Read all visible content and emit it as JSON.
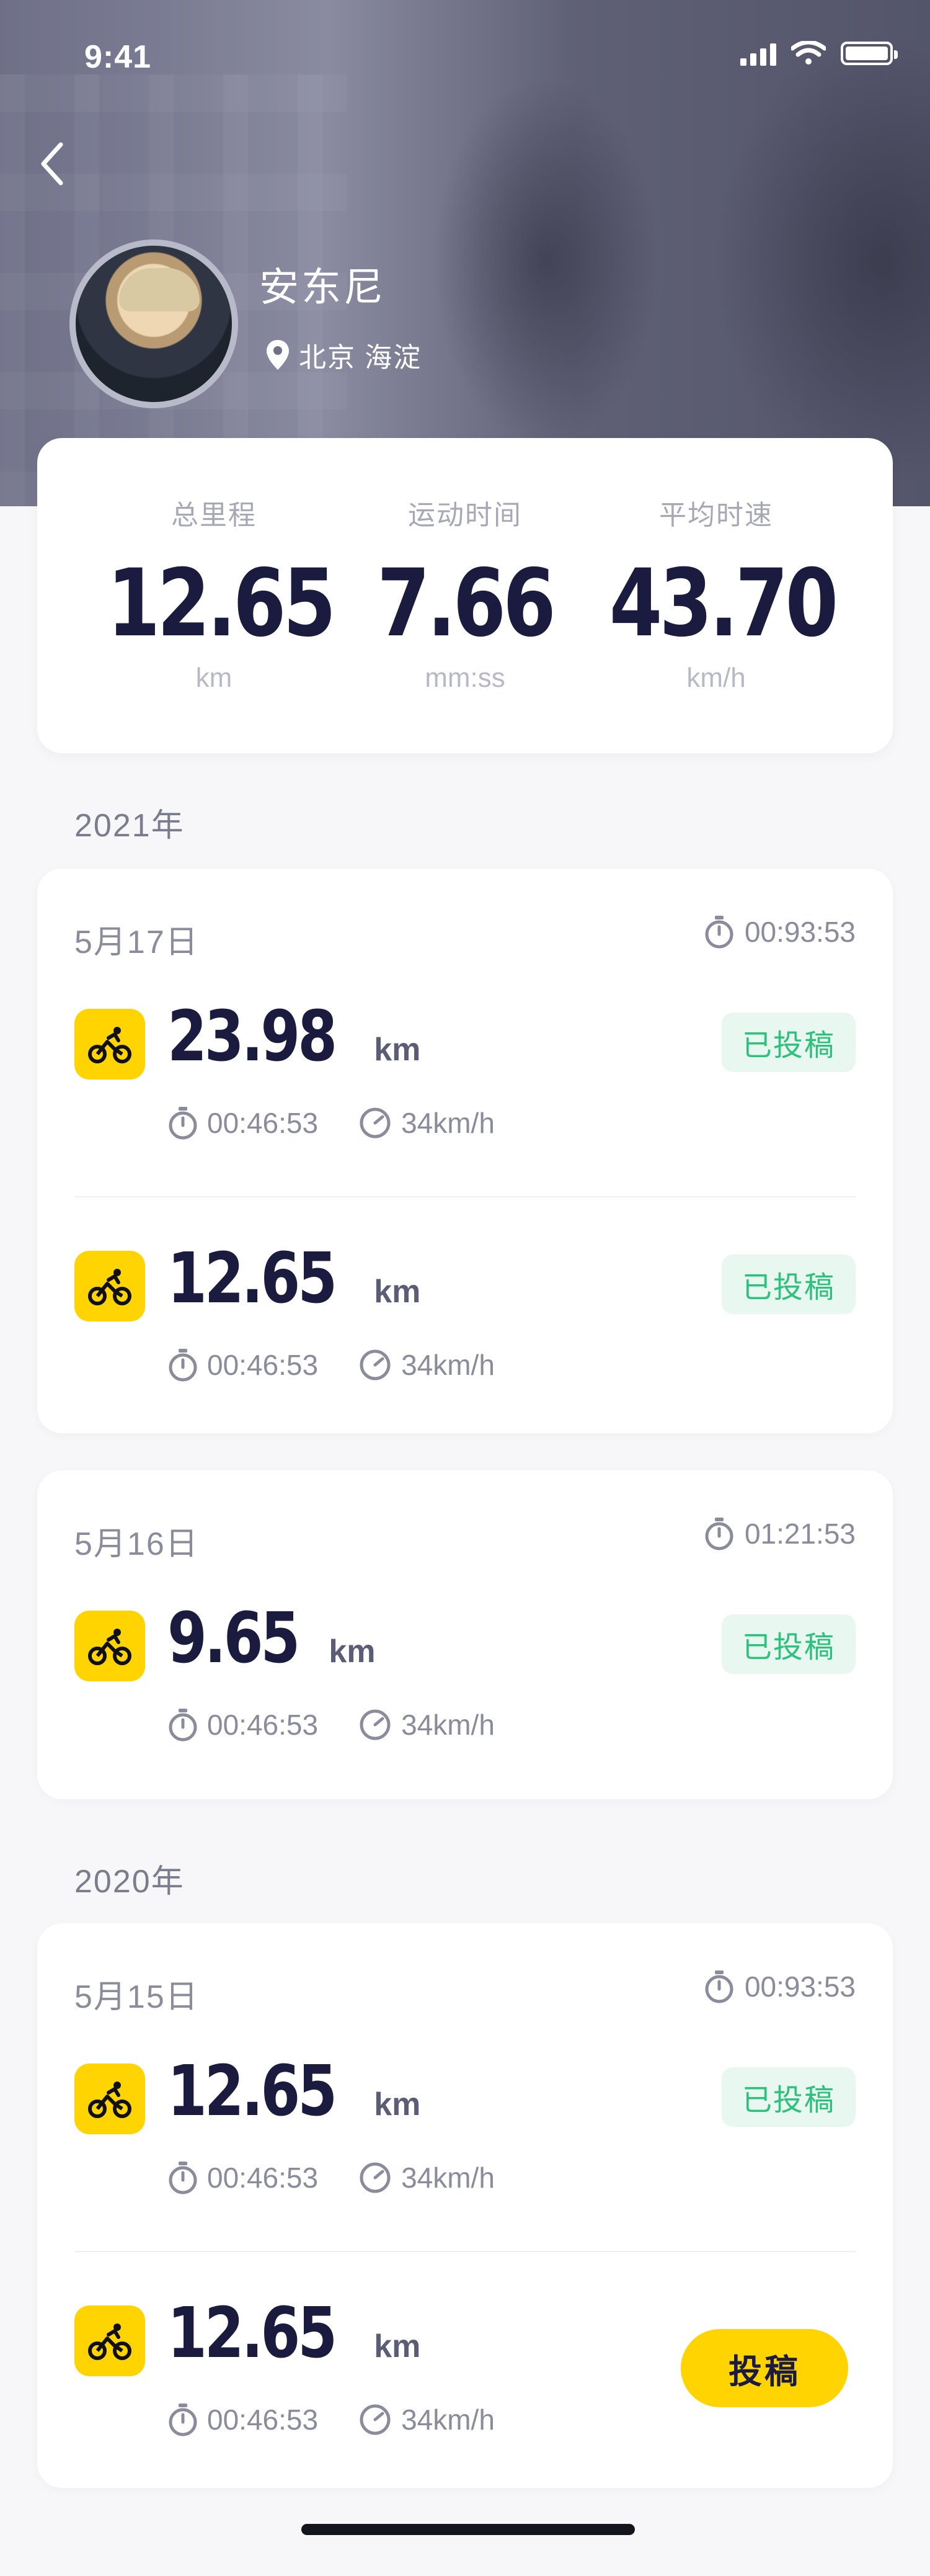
{
  "status_bar": {
    "time": "9:41"
  },
  "profile": {
    "name": "安东尼",
    "location": "北京 海淀"
  },
  "summary": [
    {
      "label": "总里程",
      "value": "12.65",
      "unit": "km"
    },
    {
      "label": "运动时间",
      "value": "7.66",
      "unit": "mm:ss"
    },
    {
      "label": "平均时速",
      "value": "43.70",
      "unit": "km/h"
    }
  ],
  "years": [
    {
      "year": "2021年",
      "days": [
        {
          "date": "5月17日",
          "total_time": "00:93:53",
          "rides": [
            {
              "distance": "23.98",
              "unit": "km",
              "duration": "00:46:53",
              "speed": "34km/h",
              "status": "已投稿"
            },
            {
              "distance": "12.65",
              "unit": "km",
              "duration": "00:46:53",
              "speed": "34km/h",
              "status": "已投稿"
            }
          ]
        },
        {
          "date": "5月16日",
          "total_time": "01:21:53",
          "rides": [
            {
              "distance": "9.65",
              "unit": "km",
              "duration": "00:46:53",
              "speed": "34km/h",
              "status": "已投稿"
            }
          ]
        }
      ]
    },
    {
      "year": "2020年",
      "days": [
        {
          "date": "5月15日",
          "total_time": "00:93:53",
          "rides": [
            {
              "distance": "12.65",
              "unit": "km",
              "duration": "00:46:53",
              "speed": "34km/h",
              "status": "已投稿"
            },
            {
              "distance": "12.65",
              "unit": "km",
              "duration": "00:46:53",
              "speed": "34km/h",
              "action": "投稿"
            }
          ]
        }
      ]
    }
  ],
  "colors": {
    "accent": "#ffd400",
    "badge_bg": "#e9f7f1",
    "badge_text": "#2ec17c",
    "title": "#1b1a3f"
  },
  "icons": {
    "back": "chevron-left-icon",
    "location": "location-pin-icon",
    "timer": "stopwatch-icon",
    "speed": "speedometer-icon",
    "bike": "cyclist-icon"
  }
}
